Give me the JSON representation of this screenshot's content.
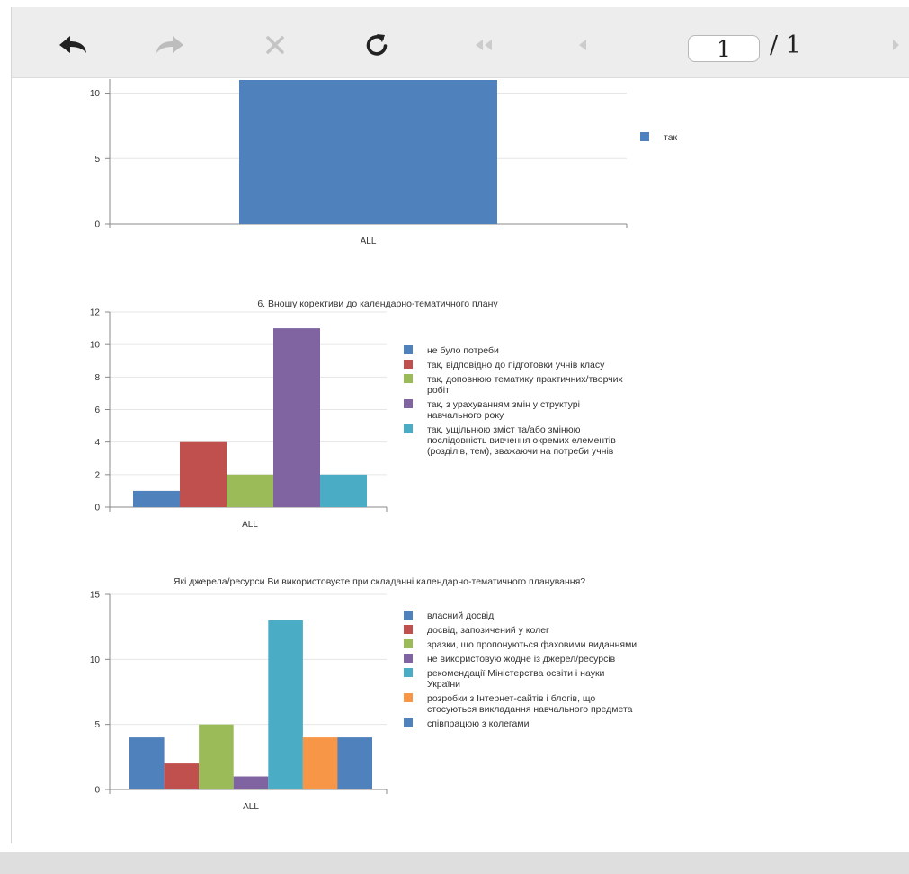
{
  "toolbar": {
    "buttons": [
      {
        "name": "back-button",
        "icon": "arrow-back-icon",
        "enabled": true
      },
      {
        "name": "forward-button",
        "icon": "arrow-forward-icon",
        "enabled": false
      },
      {
        "name": "stop-button",
        "icon": "close-icon",
        "enabled": false
      },
      {
        "name": "refresh-button",
        "icon": "refresh-icon",
        "enabled": true
      },
      {
        "name": "first-page-button",
        "icon": "double-chevron-left-icon",
        "enabled": false
      },
      {
        "name": "prev-page-button",
        "icon": "chevron-left-icon",
        "enabled": false
      },
      {
        "name": "next-page-button",
        "icon": "chevron-right-icon",
        "enabled": false
      }
    ],
    "page_current": "1",
    "page_total": "/ 1"
  },
  "colors": {
    "blue": "#4f81bd",
    "red": "#c0504d",
    "green": "#9bbb59",
    "purple": "#8064a2",
    "cyan": "#4bacc6",
    "orange": "#f79646"
  },
  "chart_data": [
    {
      "type": "bar",
      "title": "",
      "categories": [
        "ALL"
      ],
      "yticks": [
        0,
        5,
        10
      ],
      "ylim": [
        0,
        11
      ],
      "series": [
        {
          "name": "так",
          "values": [
            11
          ],
          "color": "#4f81bd"
        }
      ],
      "legend_placement": "right"
    },
    {
      "type": "bar",
      "title": "6. Вношу корективи до календарно-тематичного плану",
      "categories": [
        "ALL"
      ],
      "yticks": [
        0,
        2,
        4,
        6,
        8,
        10,
        12
      ],
      "ylim": [
        0,
        12
      ],
      "series": [
        {
          "name": "не було потреби",
          "values": [
            1
          ],
          "color": "#4f81bd"
        },
        {
          "name": "так, відповідно до підготовки учнів класу",
          "values": [
            4
          ],
          "color": "#c0504d"
        },
        {
          "name": "так, доповнюю тематику практичних/творчих робіт",
          "values": [
            2
          ],
          "color": "#9bbb59"
        },
        {
          "name": "так, з урахуванням змін у структурі навчального року",
          "values": [
            11
          ],
          "color": "#8064a2"
        },
        {
          "name": "так, ущільнюю зміст та/або змінюю послідовність вивчення окремих елементів (розділів, тем), зважаючи на потреби учнів",
          "values": [
            2
          ],
          "color": "#4bacc6"
        }
      ],
      "legend_placement": "right"
    },
    {
      "type": "bar",
      "title": "Які джерела/ресурси Ви використовуєте при складанні календарно-тематичного планування?",
      "categories": [
        "ALL"
      ],
      "yticks": [
        0,
        5,
        10,
        15
      ],
      "ylim": [
        0,
        15
      ],
      "series": [
        {
          "name": "власний досвід",
          "values": [
            4
          ],
          "color": "#4f81bd"
        },
        {
          "name": "досвід, запозичений у колег",
          "values": [
            2
          ],
          "color": "#c0504d"
        },
        {
          "name": "зразки, що пропонуються фаховими виданнями",
          "values": [
            5
          ],
          "color": "#9bbb59"
        },
        {
          "name": "не використовую жодне із джерел/ресурсів",
          "values": [
            1
          ],
          "color": "#8064a2"
        },
        {
          "name": "рекомендації Міністерства освіти і науки України",
          "values": [
            13
          ],
          "color": "#4bacc6"
        },
        {
          "name": "розробки з Інтернет-сайтів і блогів, що стосуються викладання навчального предмета",
          "values": [
            4
          ],
          "color": "#f79646"
        },
        {
          "name": "співпрацюю з колегами",
          "values": [
            4
          ],
          "color": "#4f81bd"
        }
      ],
      "legend_placement": "right"
    }
  ]
}
